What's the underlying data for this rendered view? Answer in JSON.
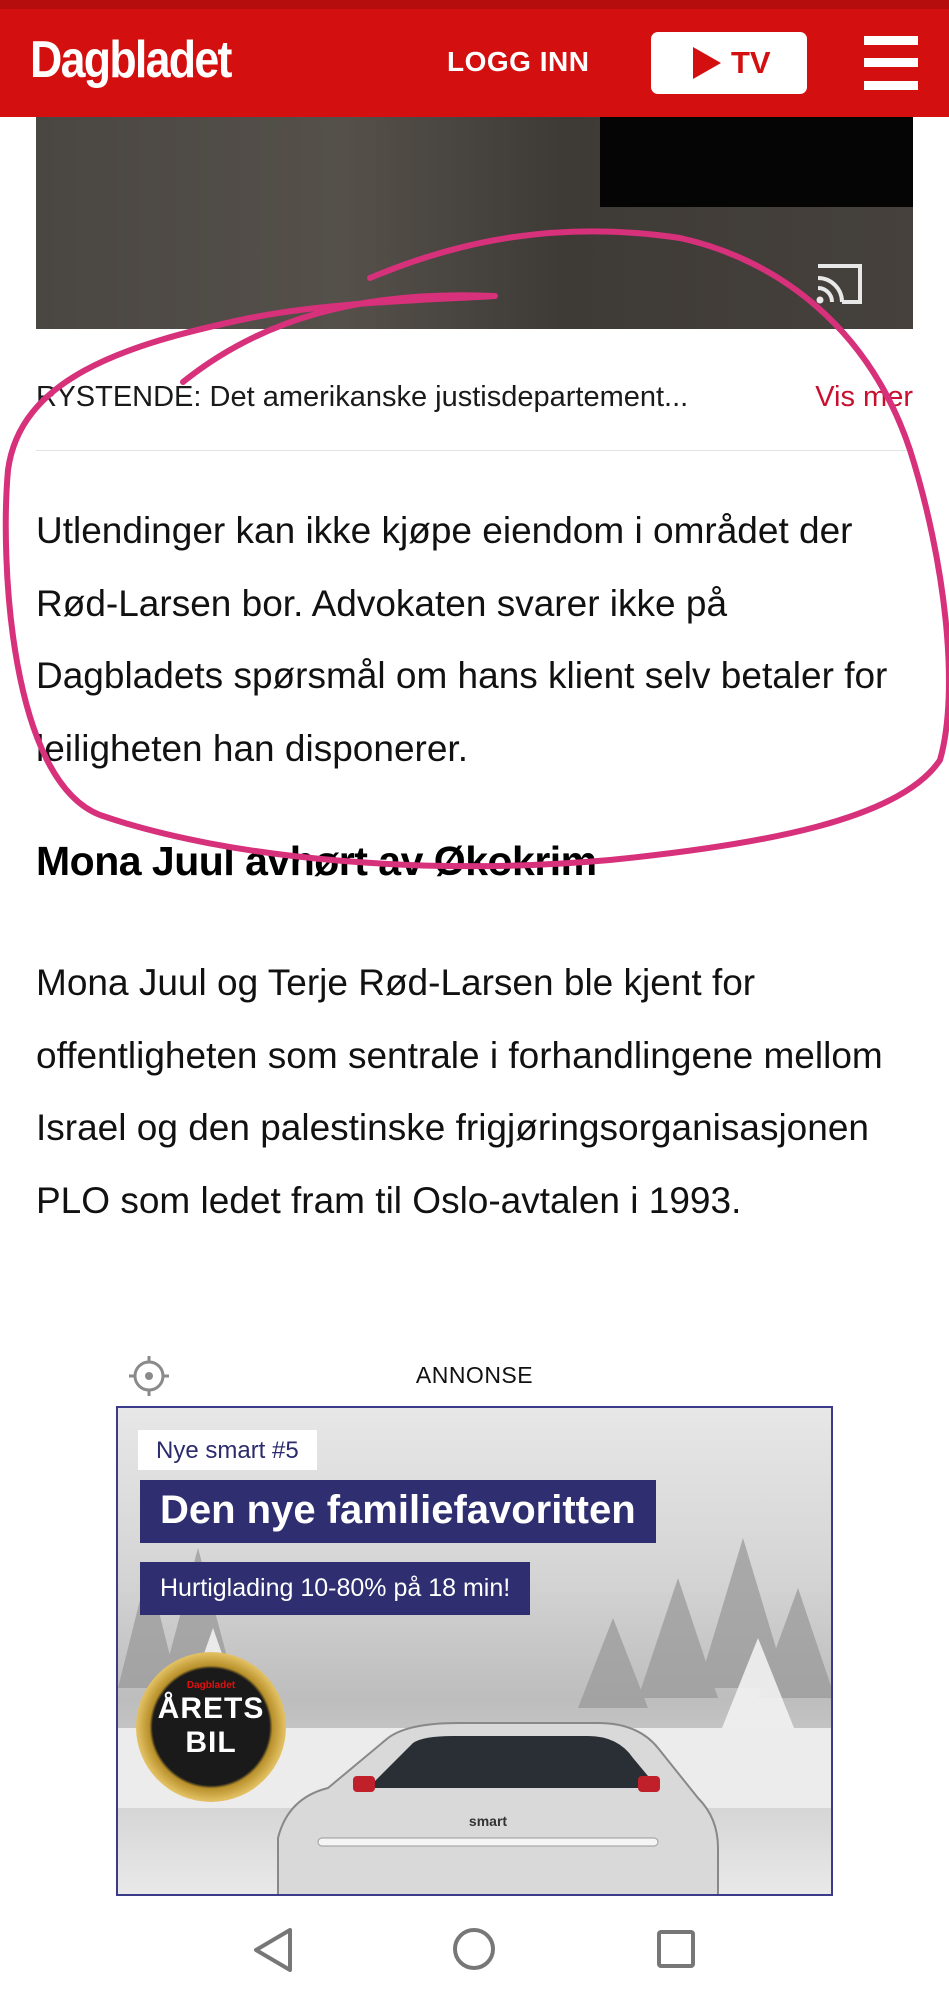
{
  "header": {
    "logo": "Dagbladet",
    "login_label": "LOGG INN",
    "tv_label": "TV",
    "brand_color": "#d30f0f"
  },
  "video": {
    "caption": "RYSTENDE: Det amerikanske justisdepartement...",
    "more_label": "Vis mer"
  },
  "article": {
    "paragraph1": "Utlendinger kan ikke kjøpe eiendom i området der Rød-Larsen bor. Advokaten svarer ikke på Dagbladets spørsmål om hans klient selv betaler for leiligheten han disponerer.",
    "subheading": "Mona Juul avhørt av Økokrim",
    "paragraph2": "Mona Juul og Terje Rød-Larsen ble kjent for offentligheten som sentrale i forhandlingene mellom Israel og den palestinske frigjøringsorganisasjonen PLO som ledet fram til Oslo-avtalen i 1993."
  },
  "ad": {
    "label": "ANNONSE",
    "tag": "Nye smart #5",
    "headline": "Den nye familiefavoritten",
    "subline": "Hurtiglading 10-80% på 18 min!",
    "badge_top": "Dagbladet",
    "badge_line1": "ÅRETS",
    "badge_line2": "BIL",
    "car_brand": "smart"
  },
  "icons": {
    "menu": "hamburger-menu-icon",
    "play": "play-icon",
    "cast": "cast-icon",
    "settings": "settings-icon",
    "nav_back": "back-triangle-icon",
    "nav_home": "home-circle-icon",
    "nav_recent": "recent-square-icon"
  },
  "annotation_color": "#d6317a"
}
